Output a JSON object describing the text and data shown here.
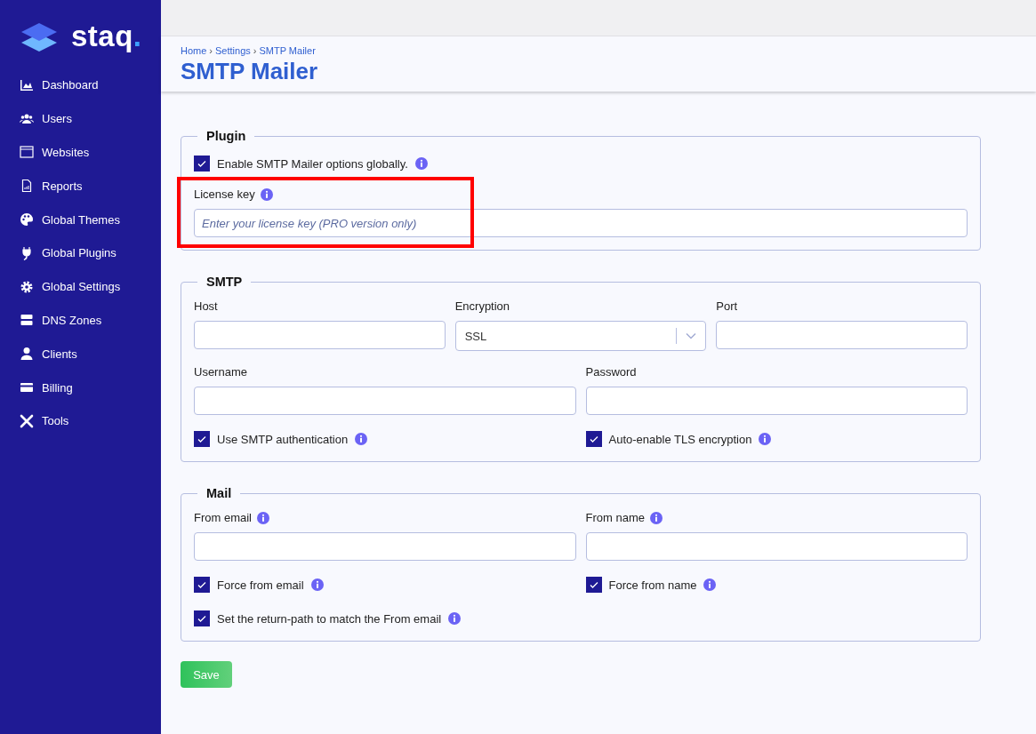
{
  "brand": {
    "name": "staq",
    "dot": "."
  },
  "sidebar": {
    "items": [
      {
        "label": "Dashboard"
      },
      {
        "label": "Users"
      },
      {
        "label": "Websites"
      },
      {
        "label": "Reports"
      },
      {
        "label": "Global Themes"
      },
      {
        "label": "Global Plugins"
      },
      {
        "label": "Global Settings"
      },
      {
        "label": "DNS Zones"
      },
      {
        "label": "Clients"
      },
      {
        "label": "Billing"
      },
      {
        "label": "Tools"
      }
    ]
  },
  "breadcrumb": [
    {
      "label": "Home"
    },
    {
      "label": "Settings"
    },
    {
      "label": "SMTP Mailer"
    }
  ],
  "breadcrumb_separator": "›",
  "page_title": "SMTP Mailer",
  "sections": [
    {
      "title": "Plugin",
      "rows": [
        [
          {
            "kind": "checkbox",
            "label": "Enable SMTP Mailer options globally.",
            "checked": true,
            "info": true
          }
        ],
        [
          {
            "kind": "field",
            "label": "License key",
            "info": true,
            "placeholder": "Enter your license key (PRO version only)"
          }
        ]
      ]
    },
    {
      "title": "SMTP",
      "rows": [
        [
          {
            "kind": "field",
            "label": "Host"
          },
          {
            "kind": "select",
            "label": "Encryption",
            "value": "SSL"
          },
          {
            "kind": "field",
            "label": "Port"
          }
        ],
        [
          {
            "kind": "field",
            "label": "Username"
          },
          {
            "kind": "field",
            "label": "Password"
          }
        ],
        [
          {
            "kind": "checkbox",
            "label": "Use SMTP authentication",
            "checked": true,
            "info": true
          },
          {
            "kind": "checkbox",
            "label": "Auto-enable TLS encryption",
            "checked": true,
            "info": true
          }
        ]
      ]
    },
    {
      "title": "Mail",
      "rows": [
        [
          {
            "kind": "field",
            "label": "From email",
            "info": true
          },
          {
            "kind": "field",
            "label": "From name",
            "info": true
          }
        ],
        [
          {
            "kind": "checkbox",
            "label": "Force from email",
            "checked": true,
            "info": true
          },
          {
            "kind": "checkbox",
            "label": "Force from name",
            "checked": true,
            "info": true
          }
        ],
        [
          {
            "kind": "checkbox",
            "label": "Set the return-path to match the From email",
            "checked": true,
            "info": true
          }
        ]
      ]
    }
  ],
  "save_button": {
    "label": "Save"
  }
}
